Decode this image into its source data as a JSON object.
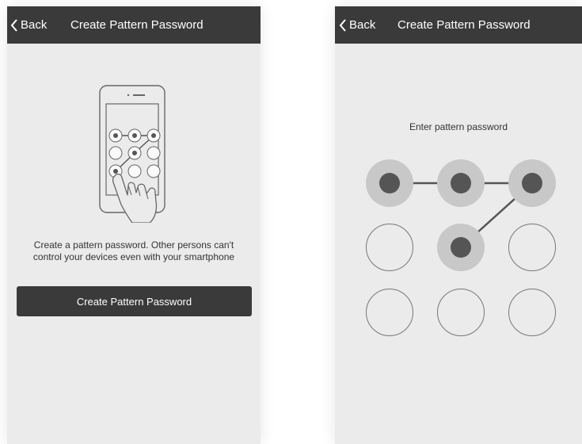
{
  "colors": {
    "navbar": "#3a3a3a",
    "screen_bg": "#ebebeb",
    "button_bg": "#3a3a3a",
    "dot_active": "#555555",
    "dot_halo": "#c8c8c8",
    "line": "#555555"
  },
  "left": {
    "nav": {
      "back_label": "Back",
      "title": "Create Pattern Password"
    },
    "description": [
      "Create a pattern password. Other persons can't",
      "control your devices even with your smartphone"
    ],
    "button_label": "Create Pattern Password",
    "illustration_icon": "phone-with-pattern-and-hand-icon"
  },
  "right": {
    "nav": {
      "back_label": "Back",
      "title": "Create Pattern Password"
    },
    "prompt": "Enter pattern password",
    "pattern": {
      "grid": [
        3,
        3
      ],
      "selected_sequence": [
        1,
        2,
        3,
        5
      ]
    }
  }
}
